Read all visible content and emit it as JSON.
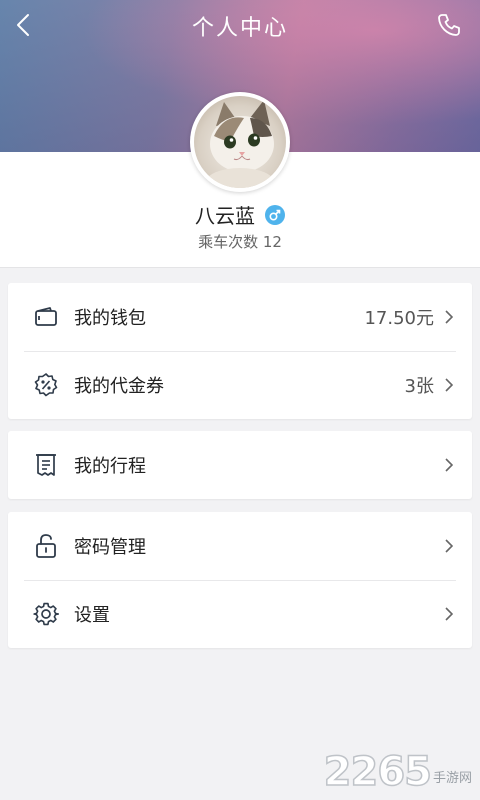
{
  "header": {
    "title": "个人中心",
    "back_icon": "chevron-left-icon",
    "phone_icon": "phone-icon"
  },
  "profile": {
    "avatar_icon": "cat-avatar",
    "name": "八云蓝",
    "gender_icon": "male-icon",
    "gender_color": "#4fb3ec",
    "rides_label": "乘车次数 12"
  },
  "menu": {
    "wallet": {
      "label": "我的钱包",
      "value": "17.50元",
      "icon": "wallet-icon"
    },
    "vouchers": {
      "label": "我的代金券",
      "value": "3张",
      "icon": "discount-icon"
    },
    "trips": {
      "label": "我的行程",
      "icon": "receipt-icon"
    },
    "password": {
      "label": "密码管理",
      "icon": "lock-icon"
    },
    "settings": {
      "label": "设置",
      "icon": "gear-icon"
    }
  },
  "watermark": {
    "number": "2265",
    "text": "手游网"
  }
}
